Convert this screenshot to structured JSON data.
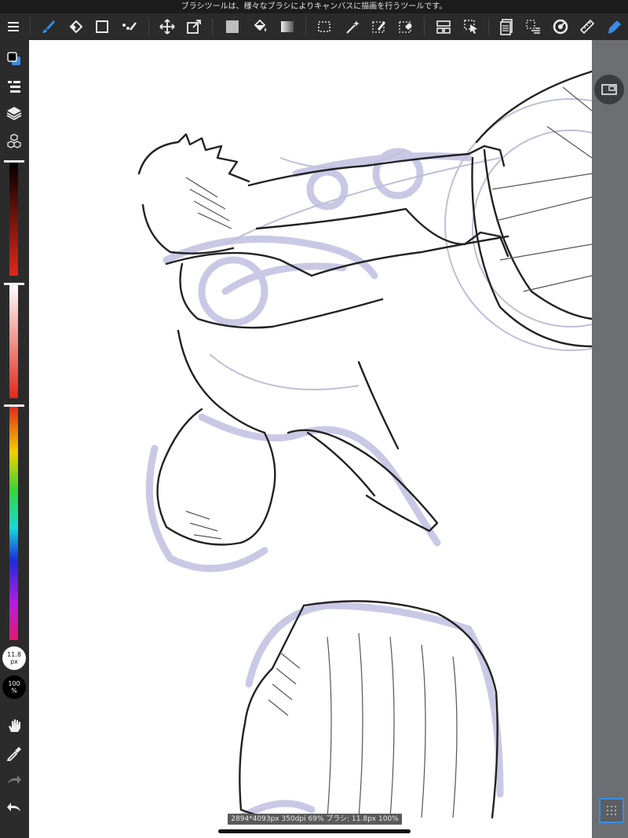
{
  "tip_bar": {
    "text": "ブラシツールは、様々なブラシによりキャンバスに描画を行うツールです。"
  },
  "toolbar": {
    "icons": [
      "menu-icon",
      "brush-icon",
      "eraser-icon",
      "rectangle-icon",
      "dot-brush-icon",
      "move-icon",
      "transform-icon",
      "fill-color-icon",
      "bucket-icon",
      "gradient-icon",
      "select-rect-icon",
      "magic-wand-icon",
      "select-pen-icon",
      "select-eraser-icon",
      "layer-layout-icon",
      "select-move-icon",
      "layers-panel-icon",
      "selection-layer-icon",
      "snap-icon",
      "ruler-icon",
      "pen-active-icon"
    ]
  },
  "sidebar": {
    "size_label": "11.8\npx",
    "opacity_label": "100\n%"
  },
  "status_bar": {
    "text": "2894*4093px 350dpi 69% ブラシ: 11.8px 100%"
  },
  "colors": {
    "accent": "#3a8ee6",
    "foreground": "#000000",
    "canvas": "#ffffff",
    "sketch_blue": "#c9c9e6",
    "panel": "#6c6e72"
  }
}
